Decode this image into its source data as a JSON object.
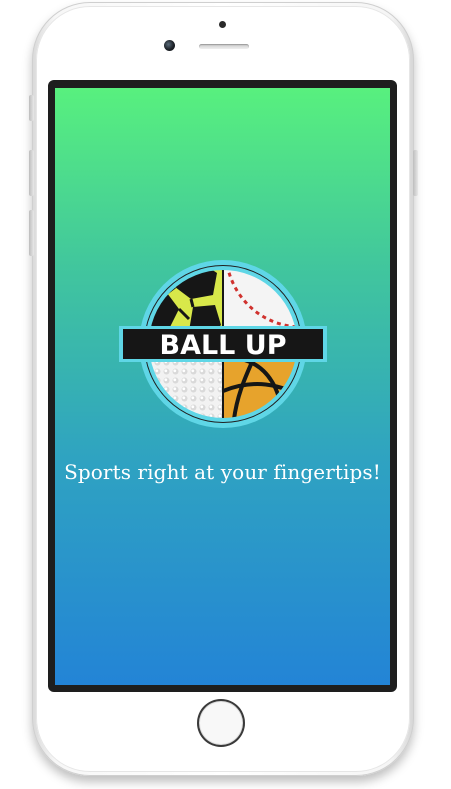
{
  "device": {
    "type": "phone",
    "frame_color": "#f5f5f5"
  },
  "screen": {
    "gradient_top": "#58f07e",
    "gradient_bottom": "#2384d6"
  },
  "logo": {
    "text": "BALL UP",
    "icon": "sports-balls-logo-icon",
    "ring_color": "#5fd6e6",
    "banner_color": "#161616"
  },
  "tagline": "Sports right at your fingertips!"
}
